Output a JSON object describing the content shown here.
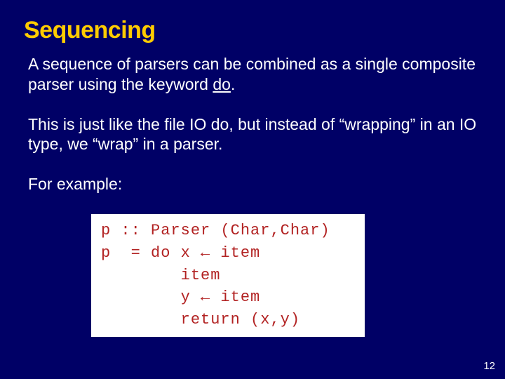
{
  "title": "Sequencing",
  "para1_a": "A sequence of parsers can be combined as a single composite parser using the keyword ",
  "para1_do": "do",
  "para1_b": ".",
  "para2": "This is just like the file IO do, but instead of “wrapping” in an IO type, we “wrap” in a parser.",
  "para3": "For example:",
  "code_line1": "p :: Parser (Char,Char)",
  "code_line2": "p  = do x ← item",
  "code_line3": "        item",
  "code_line4": "        y ← item",
  "code_line5": "        return (x,y)",
  "pagenum": "12"
}
